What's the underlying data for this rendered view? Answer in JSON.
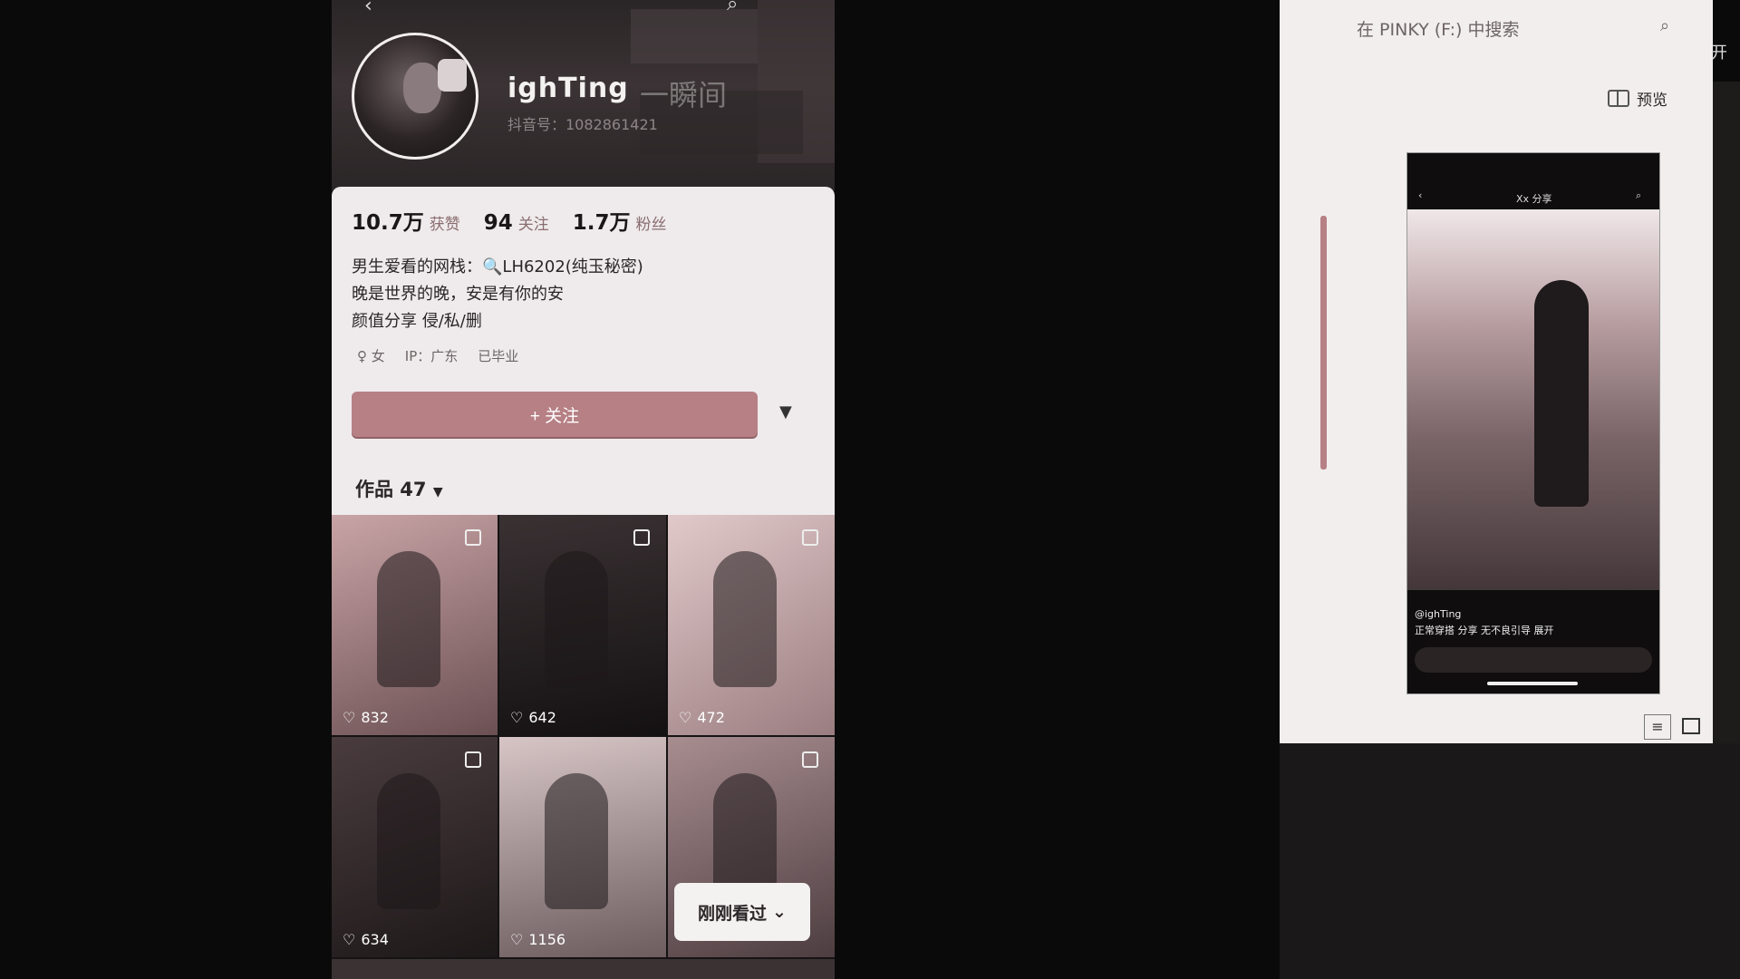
{
  "profile": {
    "name": "ighTing",
    "name_suffix": "一瞬间",
    "uid": "抖音号：1082861421",
    "stats": [
      {
        "value": "10.7万",
        "label": "获赞"
      },
      {
        "value": "94",
        "label": "关注"
      },
      {
        "value": "1.7万",
        "label": "粉丝"
      }
    ],
    "bio": [
      "男生爱看的网栈：🔍LH6202(纯玉秘密)",
      "晚是世界的晚，安是有你的安",
      "颜值分享 侵/私/删"
    ],
    "tags": [
      "♀ 女",
      "IP：广东",
      "已毕业"
    ],
    "follow_label": "+ 关注",
    "works_label": "作品 47",
    "tiles": [
      {
        "likes": "832"
      },
      {
        "likes": "642"
      },
      {
        "likes": "472"
      },
      {
        "likes": "634"
      },
      {
        "likes": "1156"
      },
      {
        "likes": ""
      }
    ],
    "recent_label": "刚刚看过"
  },
  "explorer": {
    "search_placeholder": "在 PINKY (F:) 中搜索",
    "preview_label": "预览",
    "side_text": "开",
    "thumb_title": "Xx 分享",
    "thumb_caption": "@ighTing",
    "thumb_desc": "正常穿搭 分享 无不良引导 展开"
  },
  "icons": {
    "back": "chevron-left-icon",
    "search": "search-icon",
    "heart": "heart-icon",
    "dropdown": "caret-down-icon"
  },
  "colors": {
    "accent": "#b68085",
    "card": "#efebec",
    "background": "#0b0a0a"
  }
}
